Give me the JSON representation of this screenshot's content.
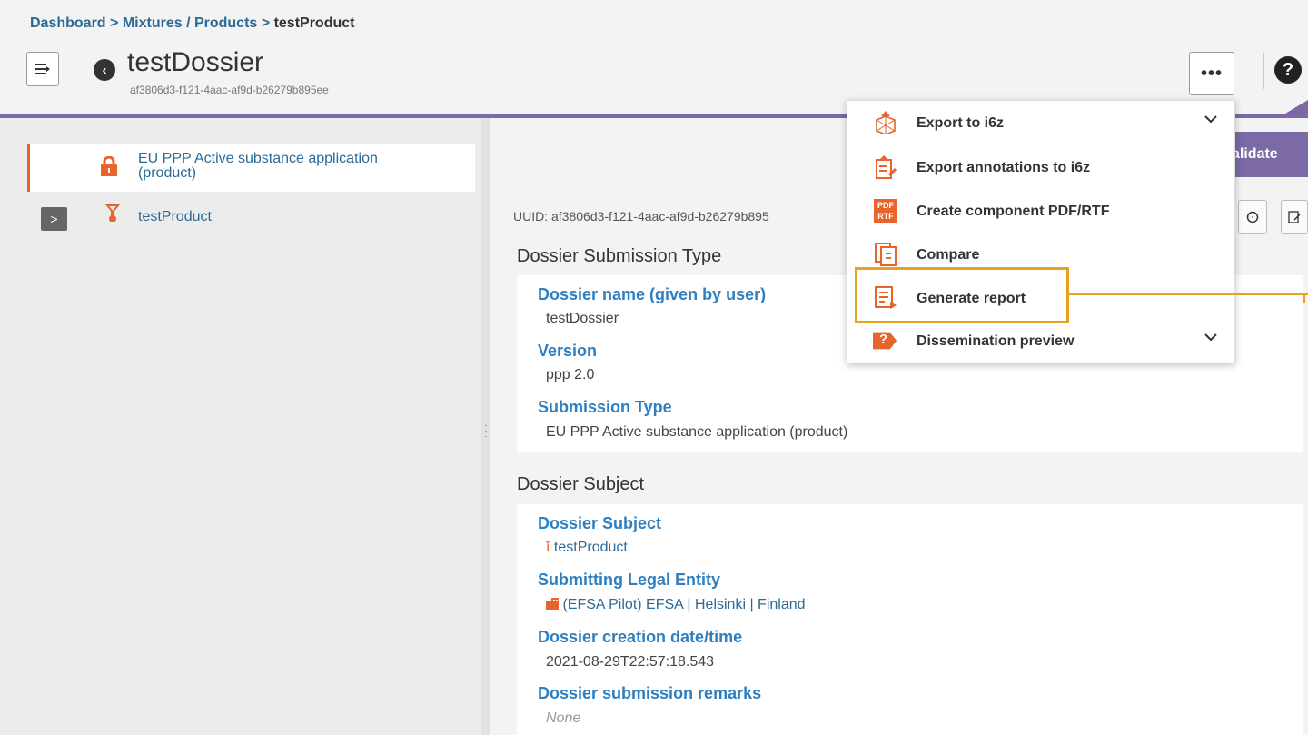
{
  "breadcrumb": {
    "items": [
      "Dashboard",
      "Mixtures / Products"
    ],
    "separator": ">",
    "current": "testProduct"
  },
  "header": {
    "title": "testDossier",
    "uuid": "af3806d3-f121-4aac-af9d-b26279b895ee",
    "more_label": "•••",
    "help_label": "?"
  },
  "tree": {
    "selected_label": "EU PPP Active substance application (product)",
    "expand_label": ">",
    "product_label": "testProduct"
  },
  "toolbar": {
    "validate_label": "alidate",
    "uuid_text": "UUID: af3806d3-f121-4aac-af9d-b26279b895"
  },
  "menu": {
    "items": [
      {
        "label": "Export to i6z",
        "icon": "export-icon",
        "has_chevron": true
      },
      {
        "label": "Export annotations to i6z",
        "icon": "export-annotations-icon",
        "has_chevron": false
      },
      {
        "label": "Create component PDF/RTF",
        "icon": "pdf-rtf-icon",
        "has_chevron": false
      },
      {
        "label": "Compare",
        "icon": "compare-icon",
        "has_chevron": false
      },
      {
        "label": "Generate report",
        "icon": "report-icon",
        "has_chevron": false
      },
      {
        "label": "Dissemination preview",
        "icon": "dissemination-icon",
        "has_chevron": true
      }
    ],
    "pdf_icon_top": "PDF",
    "pdf_icon_bottom": "RTF",
    "dissemination_icon_text": "?"
  },
  "sections": {
    "submission_type": {
      "heading": "Dossier Submission Type",
      "dossier_name_label": "Dossier name (given by user)",
      "dossier_name_value": "testDossier",
      "version_label": "Version",
      "version_value": "ppp 2.0",
      "submission_type_label": "Submission Type",
      "submission_type_value": "EU PPP Active substance application (product)"
    },
    "subject": {
      "heading": "Dossier Subject",
      "subject_label": "Dossier Subject",
      "subject_value": "testProduct",
      "legal_entity_label": "Submitting Legal Entity",
      "legal_entity_value": "(EFSA Pilot) EFSA | Helsinki | Finland",
      "creation_label": "Dossier creation date/time",
      "creation_value": "2021-08-29T22:57:18.543",
      "remarks_label": "Dossier submission remarks",
      "remarks_value": "None"
    }
  },
  "colors": {
    "accent_purple": "#7b6aa6",
    "link_blue": "#2b6a96",
    "label_blue": "#2d7fc1",
    "orange": "#e8642a",
    "highlight": "#e8a11a"
  }
}
